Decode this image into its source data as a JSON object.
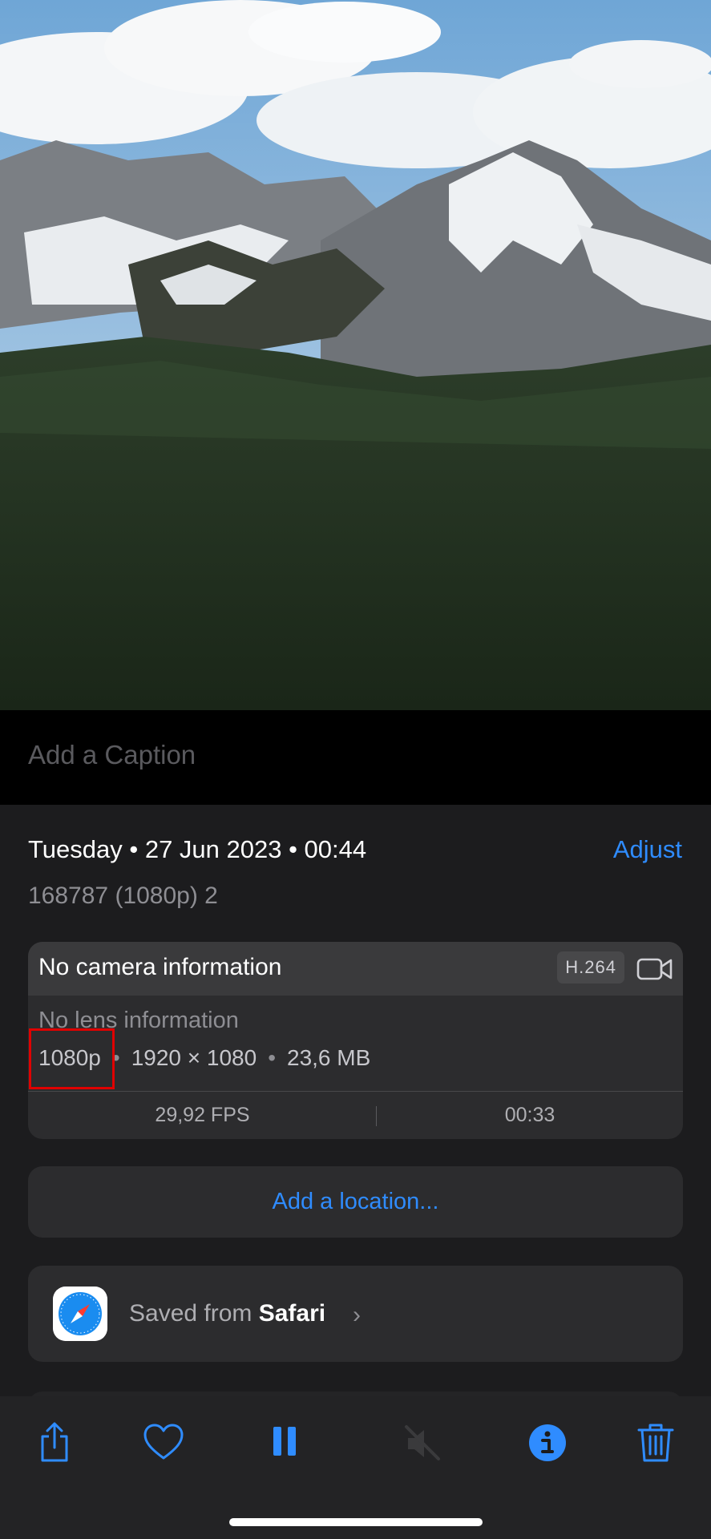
{
  "caption": {
    "placeholder": "Add a Caption"
  },
  "details": {
    "date": "Tuesday • 27 Jun 2023 • 00:44",
    "adjust_label": "Adjust",
    "filename": "168787 (1080p) 2"
  },
  "camera_card": {
    "title": "No camera information",
    "codec_badge": "H.264",
    "video_icon": "video-camera-icon",
    "lens": "No lens information",
    "resolution_label": "1080p",
    "dimensions": "1920 × 1080",
    "file_size": "23,6 MB",
    "separator": "•",
    "fps": "29,92 FPS",
    "duration": "00:33"
  },
  "location": {
    "label": "Add a location..."
  },
  "source": {
    "prefix": "Saved from ",
    "app": "Safari",
    "icon": "safari-icon"
  },
  "toolbar": {
    "icons": [
      "share-icon",
      "heart-icon",
      "pause-icon",
      "mute-icon",
      "info-icon",
      "trash-icon"
    ]
  },
  "colors": {
    "accent": "#2f8cff",
    "highlight": "#e00000",
    "background": "#1c1c1e"
  }
}
